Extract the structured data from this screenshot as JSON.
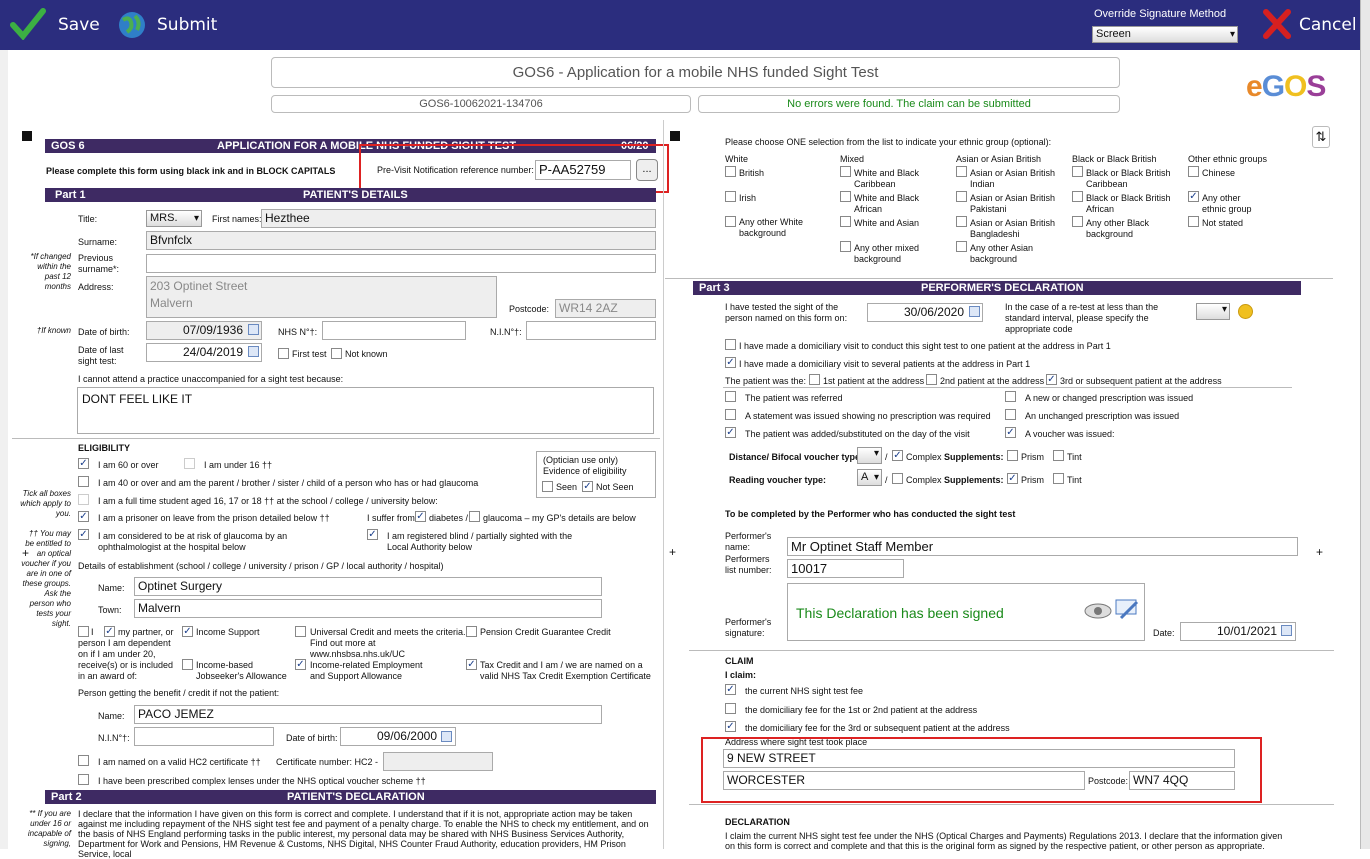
{
  "toolbar": {
    "save": "Save",
    "submit": "Submit",
    "override_label": "Override Signature Method",
    "override_value": "Screen",
    "cancel": "Cancel"
  },
  "header": {
    "title": "GOS6 - Application for a mobile NHS funded Sight Test",
    "claim_id": "GOS6-10062021-134706",
    "status": "No errors were found. The claim can be submitted",
    "logo": "eGOS"
  },
  "form": {
    "gos": "GOS 6",
    "heading": "APPLICATION FOR A MOBILE NHS FUNDED SIGHT TEST",
    "page": "06/20",
    "instruction": "Please complete this form using black ink and in BLOCK CAPITALS",
    "pvn_label": "Pre-Visit Notification reference number:",
    "pvn_value": "P-AA52759",
    "pvn_btn": "...",
    "part1": "Part 1",
    "part1_title": "PATIENT'S DETAILS",
    "title_label": "Title:",
    "title_value": "MRS.",
    "first_label": "First names:",
    "first_value": "Hezthee",
    "surname_label": "Surname:",
    "surname_value": "Bfvnfclx",
    "prev_note": "*If changed within the past 12 months",
    "prev_label": "Previous surname*:",
    "address_label": "Address:",
    "address1": "203 Optinet Street",
    "address2": "Malvern",
    "postcode_label": "Postcode:",
    "postcode": "WR14 2AZ",
    "ifknown": "†If known",
    "dob_label": "Date of birth:",
    "dob": "07/09/1936",
    "nhs_label": "NHS N°†:",
    "nin_label": "N.I.N°†:",
    "last_label": "Date of last sight test:",
    "last_value": "24/04/2019",
    "first_test": "First test",
    "not_known": "Not known",
    "reason_label": "I cannot attend a practice unaccompanied for a sight test because:",
    "reason": "DONT FEEL LIKE IT",
    "elig": "ELIGIBILITY",
    "e60": "I am 60 or over",
    "e16": "I am under 16 ††",
    "e40": "I am 40 or over and am the parent / brother / sister / child of a person who has or had glaucoma",
    "eft": "I am a full time student aged 16, 17 or 18 †† at the school / college / university below:",
    "epr": "I am a prisoner on leave from the prison detailed below ††",
    "esuf": "I suffer from",
    "edia": "diabetes /",
    "eglau": "glaucoma – my GP's details are below",
    "erisk": "I am considered to be at risk of glaucoma by an ophthalmologist at the hospital below",
    "eblind": "I am registered blind / partially sighted with the Local Authority below",
    "opt_use": "(Optician use only) Evidence of eligibility",
    "seen": "Seen",
    "notseen": "Not Seen",
    "tick_note": "Tick all boxes which apply to you.",
    "may_note": "†† You may be entitled to an optical voucher if you are in one of these groups. Ask the person who tests your sight.",
    "est_label": "Details of establishment (school / college / university / prison / GP / local authority / hospital)",
    "name_label": "Name:",
    "est_name": "Optinet Surgery",
    "town_label": "Town:",
    "est_town": "Malvern",
    "b_i": "I",
    "b_partner": "my partner, or person I am dependent on if I am under 20, receive(s) or is included in an award of:",
    "b_is": "Income Support",
    "b_uc": "Universal Credit and meets the criteria. Find out more at www.nhsbsa.nhs.uk/UC",
    "b_pc": "Pension Credit Guarantee Credit",
    "b_jsa": "Income-based Jobseeker's Allowance",
    "b_esa": "Income-related Employment and Support Allowance",
    "b_tc": "Tax Credit and I am / we are named on a valid NHS Tax Credit Exemption Certificate",
    "ben_label": "Person getting the benefit / credit if not the patient:",
    "ben_name": "PACO JEMEZ",
    "ben_dob": "09/06/2000",
    "hc2": "I am named on a valid HC2 certificate ††",
    "hc2_cert": "Certificate number: HC2 -",
    "complex": "I have been prescribed complex lenses under the NHS optical voucher scheme ††",
    "part2": "Part 2",
    "part2_title": "PATIENT'S DECLARATION",
    "under16": "** If you are under 16 or incapable of signing,",
    "declare": "I declare that the information I have given on this form is correct and complete. I understand that if it is not, appropriate action may be taken against me including repayment of the NHS sight test fee and payment of a penalty charge. To enable the NHS to check my entitlement, and on the basis of NHS England performing tasks in the public interest, my personal data may be shared with NHS Business Services Authority, Department for Work and Pensions, HM Revenue & Customs, NHS Digital, NHS Counter Fraud Authority, education providers, HM Prison Service, local"
  },
  "right": {
    "eth_q": "Please choose ONE selection from the list to indicate your ethnic group (optional):",
    "white": "White",
    "w1": "British",
    "w2": "Irish",
    "w3": "Any other White background",
    "mixed": "Mixed",
    "m1": "White and Black Caribbean",
    "m2": "White and Black African",
    "m3": "White and Asian",
    "m4": "Any other mixed background",
    "asian": "Asian or Asian British",
    "a1": "Indian",
    "a2": "Pakistani",
    "a3": "Bangladeshi",
    "a4": "Any other Asian background",
    "a_pre": "Asian or Asian British",
    "black": "Black or Black British",
    "b1": "Caribbean",
    "b2": "African",
    "b3": "Any other Black background",
    "b_pre": "Black or Black British",
    "other": "Other ethnic groups",
    "o1": "Chinese",
    "o2": "Any other ethnic group",
    "o3": "Not stated",
    "part3": "Part 3",
    "part3_title": "PERFORMER'S DECLARATION",
    "tested": "I have tested the sight of the person named on this form on:",
    "tested_date": "30/06/2020",
    "retest": "In the case of a re-test at less than the standard interval, please specify the appropriate code",
    "dom1": "I have made a domiciliary visit to conduct this sight test to one patient at the address in Part 1",
    "dom2": "I have made a domiciliary visit to several patients at the address in Part 1",
    "pw": "The patient was the:",
    "pw1": "1st patient at the address",
    "pw2": "2nd patient at the address",
    "pw3": "3rd or subsequent patient at the address",
    "ref": "The patient was referred",
    "stmt": "A statement was issued showing no prescription was required",
    "added": "The patient was added/substituted on the day of the visit",
    "newp": "A new or changed prescription was issued",
    "unch": "An unchanged prescription was issued",
    "voucher": "A voucher was issued:",
    "dist": "Distance/ Bifocal voucher type:",
    "read": "Reading voucher type:",
    "read_val": "A",
    "complex": "Complex",
    "supp": "Supplements:",
    "prism": "Prism",
    "tint": "Tint",
    "perf_head": "To be completed by the Performer who has conducted the sight test",
    "perf_name_l": "Performer's name:",
    "perf_name": "Mr Optinet Staff Member",
    "perf_list_l": "Performers list number:",
    "perf_list": "10017",
    "signed": "This Declaration has been signed",
    "sig_l": "Performer's signature:",
    "date_l": "Date:",
    "sig_date": "10/01/2021",
    "claim": "CLAIM",
    "iclaim": "I claim:",
    "c1": "the current NHS sight test fee",
    "c2": "the domiciliary fee for the 1st or 2nd patient at the address",
    "c3": "the domiciliary fee for the 3rd or subsequent patient at the address",
    "addr_l": "Address where sight test took place",
    "addr1": "9 NEW STREET",
    "addr2": "WORCESTER",
    "pc_l": "Postcode:",
    "pc": "WN7 4QQ",
    "decl": "DECLARATION",
    "decl_text": "I claim the current NHS sight test fee under the NHS (Optical Charges and Payments) Regulations 2013. I declare that the information given on this form is correct and complete and that this is the original form as signed by the respective patient, or other person as appropriate."
  },
  "colors": {
    "toolbar": "#2b2d7e",
    "part_header": "#3e2a63",
    "status_green": "#1a8a1a",
    "highlight": "#d22222"
  }
}
